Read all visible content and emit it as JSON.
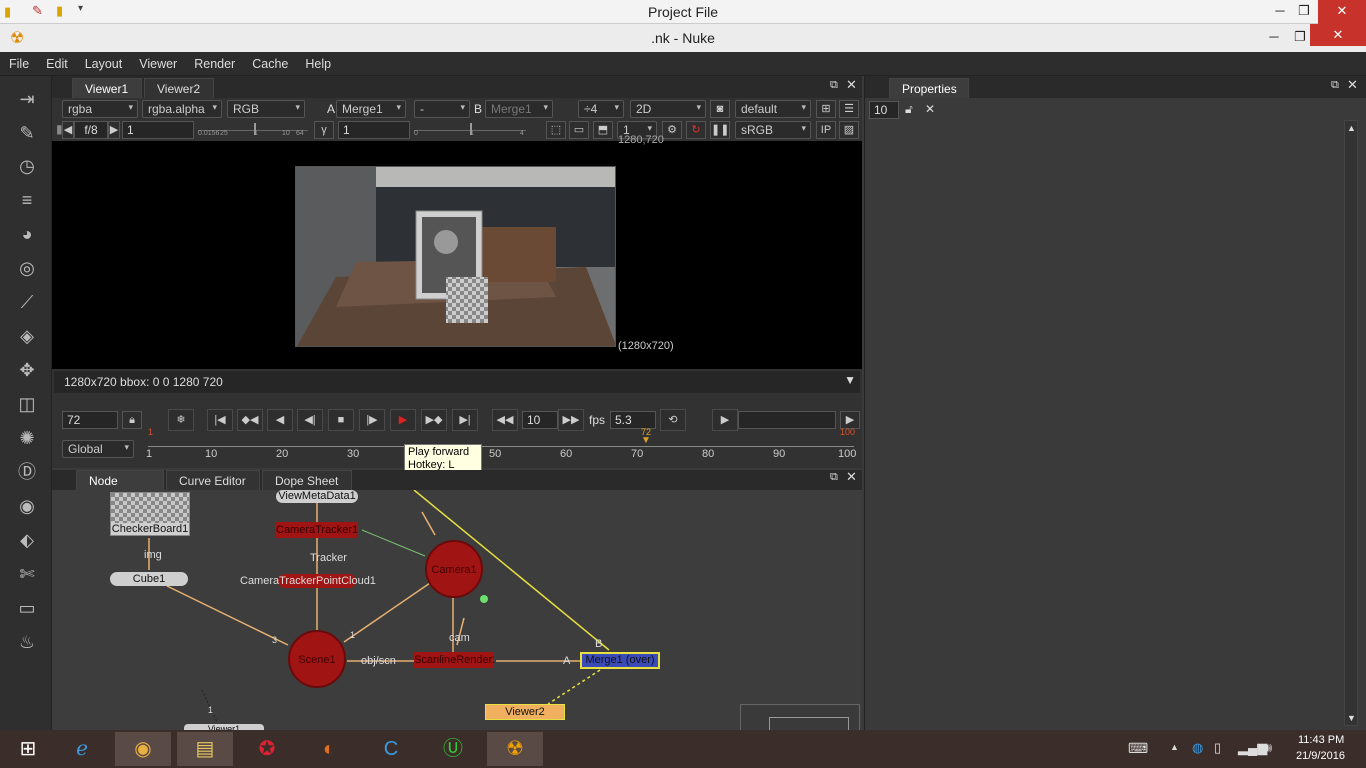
{
  "outer_window": {
    "title": "Project File"
  },
  "nuke_window": {
    "title": ".nk - Nuke"
  },
  "menu": [
    "File",
    "Edit",
    "Layout",
    "Viewer",
    "Render",
    "Cache",
    "Help"
  ],
  "viewer": {
    "tabs": [
      "Viewer1",
      "Viewer2"
    ],
    "channels": "rgba",
    "alpha": "rgba.alpha",
    "display": "RGB",
    "a_label": "A",
    "input_a": "Merge1",
    "op": "-",
    "b_label": "B",
    "input_b": "Merge1",
    "zoom": "÷4",
    "mode": "2D",
    "lut_default": "default",
    "fstop": "f/8",
    "gain": "1",
    "gamma_label": "γ",
    "gamma": "1",
    "gain_ticks": [
      "0.0156",
      "25",
      "1",
      "10",
      "64"
    ],
    "gamma_ticks": [
      "0",
      "1",
      "4"
    ],
    "proxy": "1",
    "colorspace": "sRGB",
    "ip": "IP",
    "res_top": "1280,720",
    "res_bottom": "(1280x720)",
    "bbox_info": "1280x720 bbox: 0 0 1280 720"
  },
  "transport": {
    "frame": "72",
    "increment": "10",
    "fps_label": "fps",
    "fps": "5.3",
    "range_mode": "Global",
    "ticks": [
      "1",
      "10",
      "20",
      "30",
      "40",
      "50",
      "60",
      "70",
      "80",
      "90",
      "100"
    ],
    "current_frame_marker": "72",
    "end_marker": "100",
    "start_marker": "1"
  },
  "tooltip": {
    "line1": "Play forward",
    "line2": "Hotkey: L"
  },
  "nodegraph": {
    "tabs": [
      "Node Graph",
      "Curve Editor",
      "Dope Sheet"
    ],
    "nodes": {
      "viewmeta": "ViewMetaData1",
      "checker": "CheckerBoard1",
      "img_label": "img",
      "cube": "Cube1",
      "cameratracker": "CameraTracker1",
      "tracker_label": "Tracker",
      "pointcloud": "CameraTrackerPointCloud1",
      "camera": "Camera1",
      "scene": "Scene1",
      "objscn_label": "obj/scn",
      "cam_label": "cam",
      "scanline": "ScanlineRender1",
      "merge": "Merge1 (over)",
      "viewer2": "Viewer2",
      "viewer1": "Viewer1",
      "a_input": "A",
      "b_input": "B",
      "num1": "1",
      "num3": "3",
      "num1b": "1"
    }
  },
  "properties": {
    "title": "Properties",
    "max_panels": "10"
  },
  "taskbar": {
    "time": "11:43 PM",
    "date": "21/9/2016"
  }
}
